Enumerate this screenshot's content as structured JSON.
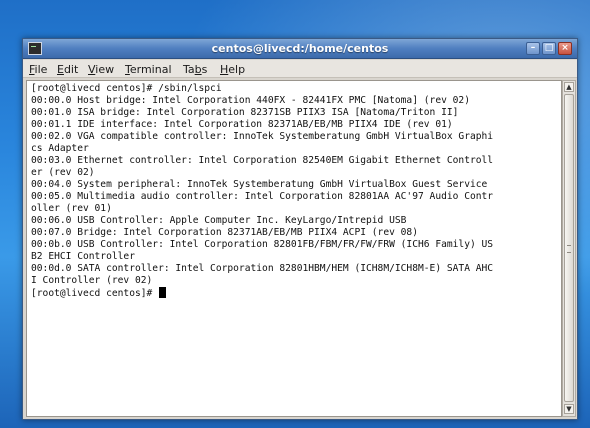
{
  "window": {
    "title": "centos@livecd:/home/centos",
    "min_glyph": "–",
    "max_glyph": "□",
    "close_glyph": "×"
  },
  "menu": [
    {
      "mnemonic": "F",
      "rest": "ile"
    },
    {
      "mnemonic": "E",
      "rest": "dit"
    },
    {
      "mnemonic": "V",
      "rest": "iew"
    },
    {
      "mnemonic": "T",
      "rest": "erminal"
    },
    {
      "pre": "Ta",
      "mnemonic": "b",
      "rest": "s"
    },
    {
      "mnemonic": "H",
      "rest": "elp"
    }
  ],
  "terminal": {
    "lines": [
      "[root@livecd centos]# /sbin/lspci",
      "00:00.0 Host bridge: Intel Corporation 440FX - 82441FX PMC [Natoma] (rev 02)",
      "00:01.0 ISA bridge: Intel Corporation 82371SB PIIX3 ISA [Natoma/Triton II]",
      "00:01.1 IDE interface: Intel Corporation 82371AB/EB/MB PIIX4 IDE (rev 01)",
      "00:02.0 VGA compatible controller: InnoTek Systemberatung GmbH VirtualBox Graphi",
      "cs Adapter",
      "00:03.0 Ethernet controller: Intel Corporation 82540EM Gigabit Ethernet Controll",
      "er (rev 02)",
      "00:04.0 System peripheral: InnoTek Systemberatung GmbH VirtualBox Guest Service",
      "00:05.0 Multimedia audio controller: Intel Corporation 82801AA AC'97 Audio Contr",
      "oller (rev 01)",
      "00:06.0 USB Controller: Apple Computer Inc. KeyLargo/Intrepid USB",
      "00:07.0 Bridge: Intel Corporation 82371AB/EB/MB PIIX4 ACPI (rev 08)",
      "00:0b.0 USB Controller: Intel Corporation 82801FB/FBM/FR/FW/FRW (ICH6 Family) US",
      "B2 EHCI Controller",
      "00:0d.0 SATA controller: Intel Corporation 82801HBM/HEM (ICH8M/ICH8M-E) SATA AHC",
      "I Controller (rev 02)"
    ],
    "prompt": "[root@livecd centos]# "
  },
  "scrollbar": {
    "up_glyph": "▲",
    "down_glyph": "▼"
  }
}
